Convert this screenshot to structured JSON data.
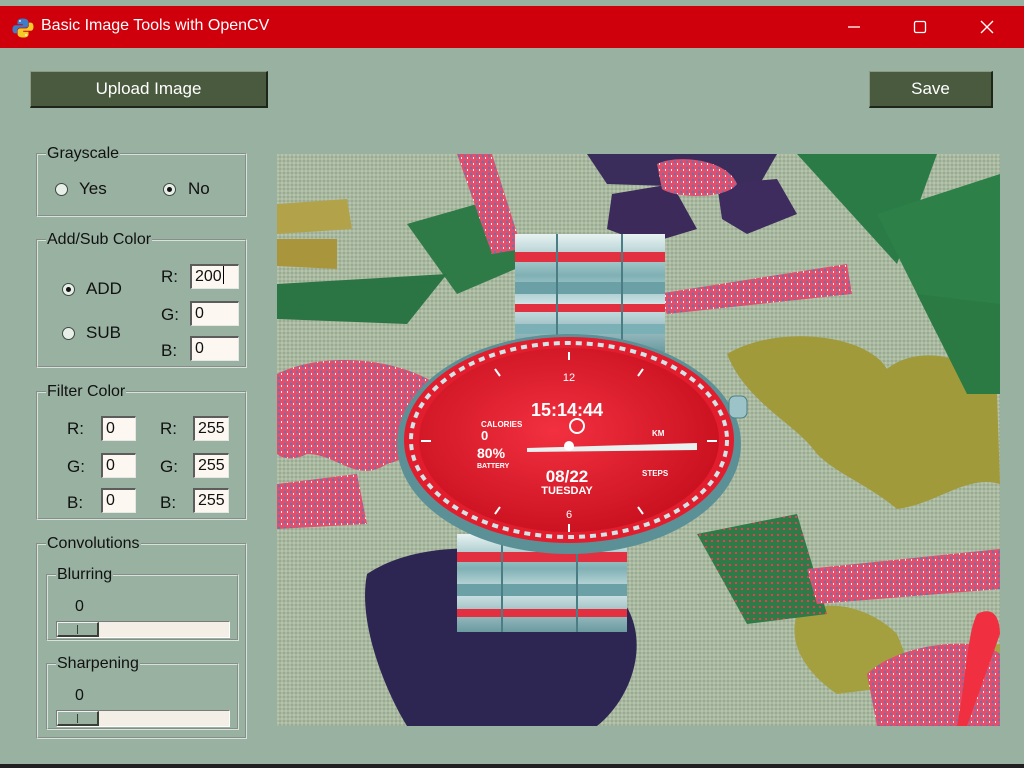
{
  "window": {
    "title": "Basic Image Tools with OpenCV",
    "app_icon": "python-icon",
    "controls": [
      "minimize-icon",
      "maximize-icon",
      "close-icon"
    ],
    "colors": {
      "titlebar": "#cf000b",
      "background": "#98b1a0",
      "button": "#4a5a3f"
    }
  },
  "toolbar": {
    "upload_label": "Upload Image",
    "save_label": "Save"
  },
  "grayscale": {
    "title": "Grayscale",
    "options": [
      {
        "label": "Yes",
        "selected": false
      },
      {
        "label": "No",
        "selected": true
      }
    ]
  },
  "addsub": {
    "title": "Add/Sub Color",
    "options": [
      {
        "label": "ADD",
        "selected": true
      },
      {
        "label": "SUB",
        "selected": false
      }
    ],
    "fields": [
      {
        "label": "R:",
        "value": "200"
      },
      {
        "label": "G:",
        "value": "0"
      },
      {
        "label": "B:",
        "value": "0"
      }
    ]
  },
  "filter": {
    "title": "Filter Color",
    "low": [
      {
        "label": "R:",
        "value": "0"
      },
      {
        "label": "G:",
        "value": "0"
      },
      {
        "label": "B:",
        "value": "0"
      }
    ],
    "high": [
      {
        "label": "R:",
        "value": "255"
      },
      {
        "label": "G:",
        "value": "255"
      },
      {
        "label": "B:",
        "value": "255"
      }
    ]
  },
  "convolutions": {
    "title": "Convolutions",
    "blurring": {
      "title": "Blurring",
      "value": "0"
    },
    "sharpening": {
      "title": "Sharpening",
      "value": "0"
    }
  },
  "image": {
    "watch_face": {
      "time": "15:14:44",
      "calories_label": "CALORIES",
      "calories": "0",
      "battery": "80%",
      "battery_label": "BATTERY",
      "date": "08/22",
      "weekday": "TUESDAY",
      "km_label": "KM",
      "steps_label": "STEPS"
    }
  }
}
